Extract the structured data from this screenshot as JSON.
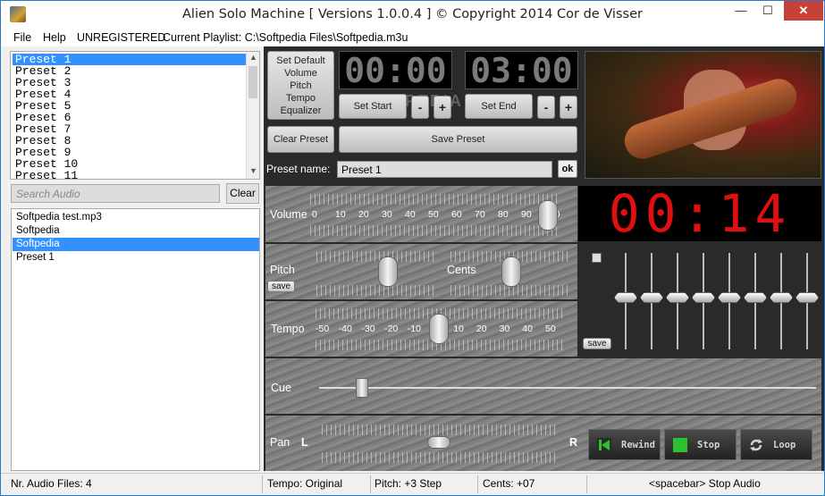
{
  "window": {
    "title": "Alien Solo Machine [ Versions 1.0.0.4 ] © Copyright 2014 Cor de Visser",
    "minimize": "—",
    "maximize": "☐",
    "close": "✕"
  },
  "menu": {
    "file": "File",
    "help": "Help",
    "registration": "UNREGISTERED",
    "playlist": "Current Playlist: C:\\Softpedia Files\\Softpedia.m3u"
  },
  "presets": [
    "Preset 1",
    "Preset 2",
    "Preset 3",
    "Preset 4",
    "Preset 5",
    "Preset 6",
    "Preset 7",
    "Preset 8",
    "Preset 9",
    "Preset 10",
    "Preset 11"
  ],
  "selected_preset": "Preset 1",
  "search": {
    "placeholder": "Search Audio",
    "clear_label": "Clear"
  },
  "audio_files": [
    "Softpedia test.mp3",
    "Softpedia",
    "Softpedia",
    "Preset 1"
  ],
  "selected_audio_index": 2,
  "controls": {
    "set_default": "Set Default",
    "set_default_items": [
      "Volume",
      "Pitch",
      "Tempo",
      "Equalizer"
    ],
    "clear_preset": "Clear Preset",
    "save_preset": "Save Preset",
    "set_start": "Set Start",
    "set_end": "Set End",
    "minus": "-",
    "plus": "+",
    "start_time": "00:00",
    "end_time": "03:00",
    "watermark": "SOFTPEDIA",
    "preset_name_label": "Preset name:",
    "preset_name_value": "Preset 1",
    "ok": "ok"
  },
  "clock": "00:14",
  "volume": {
    "label": "Volume",
    "scale": [
      "0",
      "10",
      "20",
      "30",
      "40",
      "50",
      "60",
      "70",
      "80",
      "90",
      "100"
    ],
    "value": 100
  },
  "pitch": {
    "label": "Pitch",
    "save": "save",
    "value": 3
  },
  "cents": {
    "label": "Cents",
    "value": 7
  },
  "tempo": {
    "label": "Tempo",
    "scale": [
      "-50",
      "-40",
      "-30",
      "-20",
      "-10",
      "0",
      "10",
      "20",
      "30",
      "40",
      "50"
    ],
    "value": 0
  },
  "equalizer": {
    "save": "save",
    "bands": 8
  },
  "cue": {
    "label": "Cue"
  },
  "pan": {
    "label": "Pan",
    "left": "L",
    "right": "R"
  },
  "transport": {
    "rewind": "Rewind",
    "stop": "Stop",
    "loop": "Loop",
    "accent": "#2fc032"
  },
  "status": {
    "files": "Nr. Audio Files: 4",
    "tempo": "Tempo: Original",
    "pitch": "Pitch: +3 Step",
    "cents": "Cents: +07",
    "hint": "<spacebar> Stop Audio"
  }
}
